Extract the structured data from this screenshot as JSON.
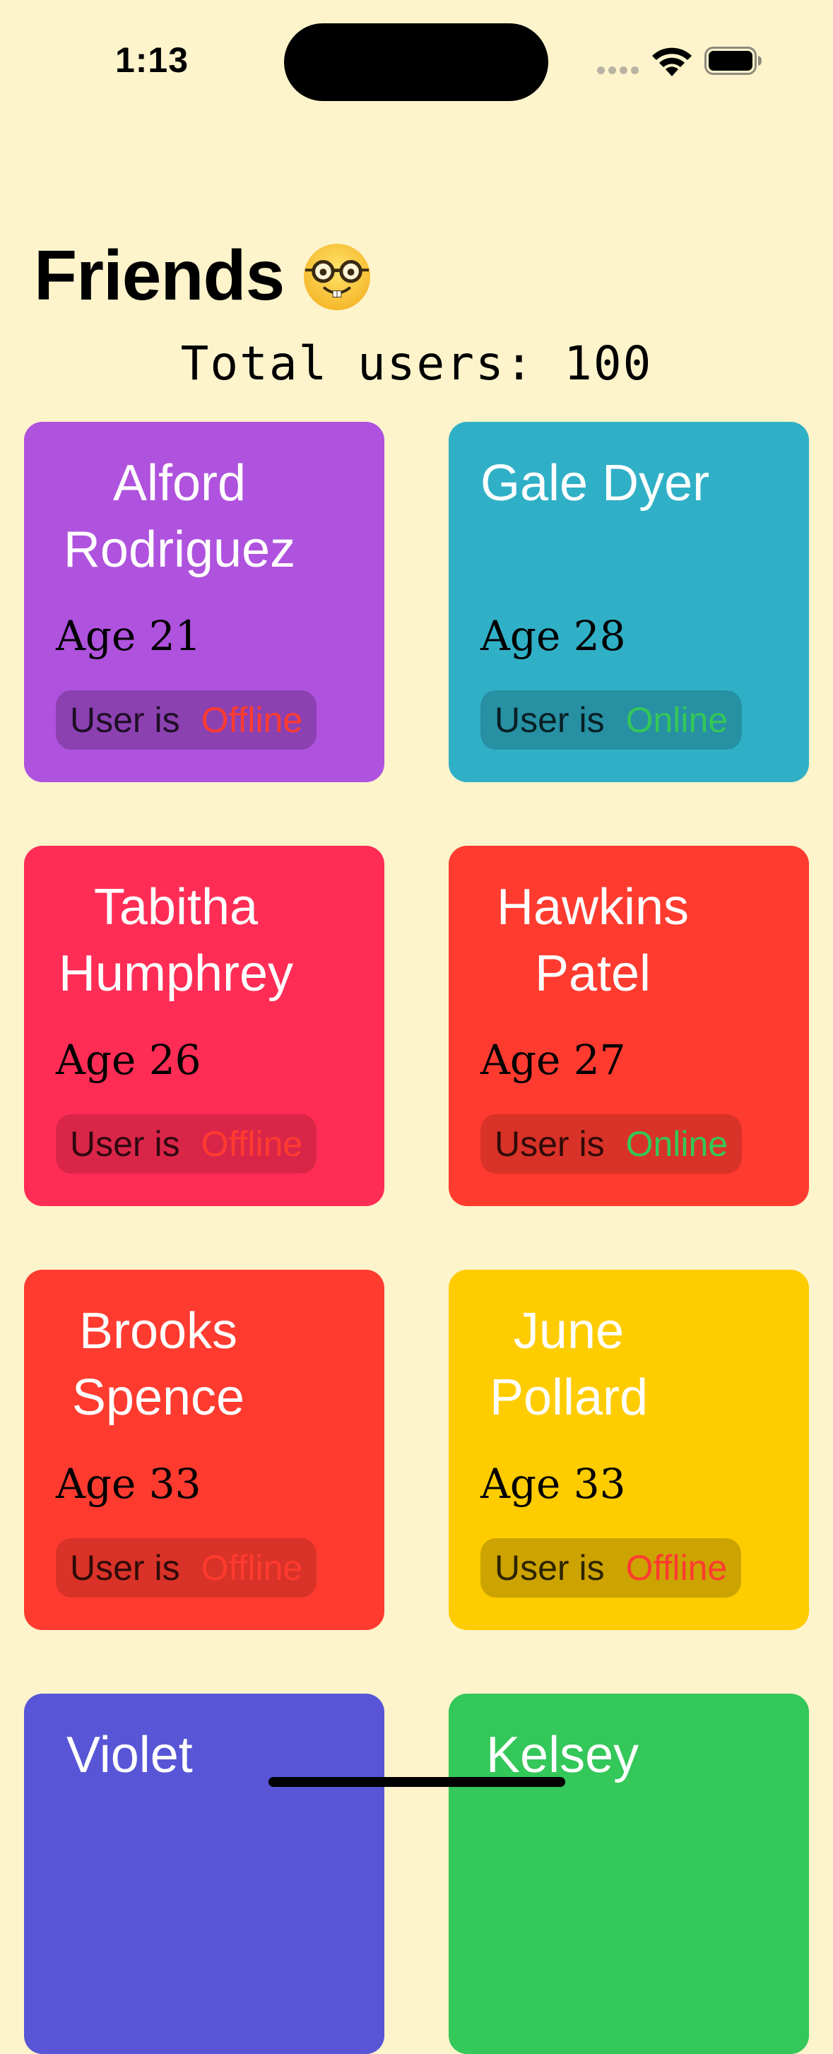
{
  "status_bar": {
    "time": "1:13"
  },
  "header": {
    "title": "Friends",
    "title_icon": "nerd-face-icon",
    "subtitle": "Total users: 100"
  },
  "status_prefix": "User is",
  "friends": [
    {
      "name": "Alford Rodriguez",
      "age": "Age 21",
      "status": "Offline",
      "color": "#AF52DE"
    },
    {
      "name": "Gale Dyer",
      "age": "Age 28",
      "status": "Online",
      "color": "#30B0C7"
    },
    {
      "name": "Tabitha Humphrey",
      "age": "Age 26",
      "status": "Offline",
      "color": "#FF2D55"
    },
    {
      "name": "Hawkins Patel",
      "age": "Age 27",
      "status": "Online",
      "color": "#FF3B30"
    },
    {
      "name": "Brooks Spence",
      "age": "Age 33",
      "status": "Offline",
      "color": "#FF3B30"
    },
    {
      "name": "June Pollard",
      "age": "Age 33",
      "status": "Offline",
      "color": "#FFCC00"
    },
    {
      "name": "Violet",
      "age": "",
      "status": "",
      "color": "#5856D6"
    },
    {
      "name": "Kelsey",
      "age": "",
      "status": "",
      "color": "#34C759"
    }
  ],
  "colors": {
    "background": "#FDF4CC",
    "offline": "#FF3B30",
    "online": "#34C759"
  }
}
